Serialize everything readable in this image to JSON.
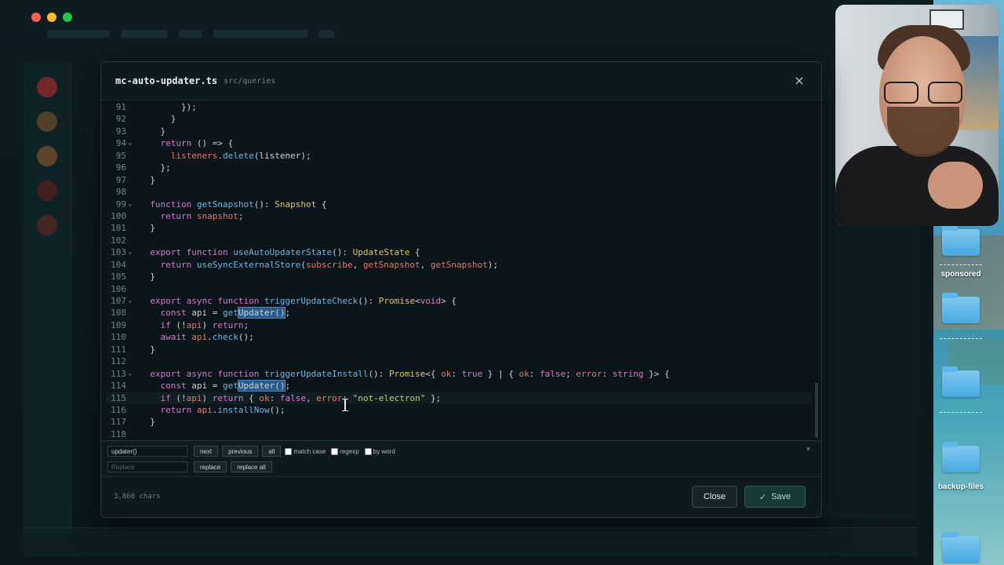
{
  "modal": {
    "filename": "mc-auto-updater.ts",
    "path": "src/queries",
    "close_icon": "×"
  },
  "editor": {
    "lines": [
      {
        "n": "91",
        "fold": "",
        "tokens": [
          [
            "id",
            "        });"
          ]
        ]
      },
      {
        "n": "92",
        "fold": "",
        "tokens": [
          [
            "id",
            "      }"
          ]
        ]
      },
      {
        "n": "93",
        "fold": "",
        "tokens": [
          [
            "id",
            "    }"
          ]
        ]
      },
      {
        "n": "94",
        "fold": "⌄",
        "tokens": [
          [
            "id",
            "    "
          ],
          [
            "kw",
            "return"
          ],
          [
            "id",
            " () => {"
          ]
        ]
      },
      {
        "n": "95",
        "fold": "",
        "tokens": [
          [
            "id",
            "      "
          ],
          [
            "pr",
            "listeners"
          ],
          [
            "id",
            "."
          ],
          [
            "fn",
            "delete"
          ],
          [
            "id",
            "(listener);"
          ]
        ]
      },
      {
        "n": "96",
        "fold": "",
        "tokens": [
          [
            "id",
            "    };"
          ]
        ]
      },
      {
        "n": "97",
        "fold": "",
        "tokens": [
          [
            "id",
            "  }"
          ]
        ]
      },
      {
        "n": "98",
        "fold": "",
        "tokens": []
      },
      {
        "n": "99",
        "fold": "⌄",
        "tokens": [
          [
            "id",
            "  "
          ],
          [
            "kw",
            "function"
          ],
          [
            "id",
            " "
          ],
          [
            "fn",
            "getSnapshot"
          ],
          [
            "id",
            "(): "
          ],
          [
            "ty",
            "Snapshot"
          ],
          [
            "id",
            " {"
          ]
        ]
      },
      {
        "n": "100",
        "fold": "",
        "tokens": [
          [
            "id",
            "    "
          ],
          [
            "kw",
            "return"
          ],
          [
            "id",
            " "
          ],
          [
            "pr",
            "snapshot"
          ],
          [
            "id",
            ";"
          ]
        ]
      },
      {
        "n": "101",
        "fold": "",
        "tokens": [
          [
            "id",
            "  }"
          ]
        ]
      },
      {
        "n": "102",
        "fold": "",
        "tokens": []
      },
      {
        "n": "103",
        "fold": "⌄",
        "tokens": [
          [
            "id",
            "  "
          ],
          [
            "kw",
            "export"
          ],
          [
            "id",
            " "
          ],
          [
            "kw",
            "function"
          ],
          [
            "id",
            " "
          ],
          [
            "fn",
            "useAutoUpdaterState"
          ],
          [
            "id",
            "(): "
          ],
          [
            "ty",
            "UpdateState"
          ],
          [
            "id",
            " {"
          ]
        ]
      },
      {
        "n": "104",
        "fold": "",
        "tokens": [
          [
            "id",
            "    "
          ],
          [
            "kw",
            "return"
          ],
          [
            "id",
            " "
          ],
          [
            "fn",
            "useSyncExternalStore"
          ],
          [
            "id",
            "("
          ],
          [
            "pr",
            "subscribe"
          ],
          [
            "id",
            ", "
          ],
          [
            "pr",
            "getSnapshot"
          ],
          [
            "id",
            ", "
          ],
          [
            "pr",
            "getSnapshot"
          ],
          [
            "id",
            ");"
          ]
        ]
      },
      {
        "n": "105",
        "fold": "",
        "tokens": [
          [
            "id",
            "  }"
          ]
        ]
      },
      {
        "n": "106",
        "fold": "",
        "tokens": []
      },
      {
        "n": "107",
        "fold": "⌄",
        "tokens": [
          [
            "id",
            "  "
          ],
          [
            "kw",
            "export"
          ],
          [
            "id",
            " "
          ],
          [
            "kw",
            "async"
          ],
          [
            "id",
            " "
          ],
          [
            "kw",
            "function"
          ],
          [
            "id",
            " "
          ],
          [
            "fn",
            "triggerUpdateCheck"
          ],
          [
            "id",
            "(): "
          ],
          [
            "ty",
            "Promise"
          ],
          [
            "id",
            "<"
          ],
          [
            "kw",
            "void"
          ],
          [
            "id",
            "> {"
          ]
        ]
      },
      {
        "n": "108",
        "fold": "",
        "tokens": [
          [
            "id",
            "    "
          ],
          [
            "kw",
            "const"
          ],
          [
            "id",
            " api = "
          ],
          [
            "fn",
            "get"
          ],
          [
            "hl",
            "Updater()"
          ],
          [
            "id",
            ";"
          ]
        ]
      },
      {
        "n": "109",
        "fold": "",
        "tokens": [
          [
            "id",
            "    "
          ],
          [
            "kw",
            "if"
          ],
          [
            "id",
            " (!"
          ],
          [
            "pr",
            "api"
          ],
          [
            "id",
            ") "
          ],
          [
            "kw",
            "return"
          ],
          [
            "id",
            ";"
          ]
        ]
      },
      {
        "n": "110",
        "fold": "",
        "tokens": [
          [
            "id",
            "    "
          ],
          [
            "kw",
            "await"
          ],
          [
            "id",
            " "
          ],
          [
            "pr",
            "api"
          ],
          [
            "id",
            "."
          ],
          [
            "fn",
            "check"
          ],
          [
            "id",
            "();"
          ]
        ]
      },
      {
        "n": "111",
        "fold": "",
        "tokens": [
          [
            "id",
            "  }"
          ]
        ]
      },
      {
        "n": "112",
        "fold": "",
        "tokens": []
      },
      {
        "n": "113",
        "fold": "⌄",
        "tokens": [
          [
            "id",
            "  "
          ],
          [
            "kw",
            "export"
          ],
          [
            "id",
            " "
          ],
          [
            "kw",
            "async"
          ],
          [
            "id",
            " "
          ],
          [
            "kw",
            "function"
          ],
          [
            "id",
            " "
          ],
          [
            "fn",
            "triggerUpdateInstall"
          ],
          [
            "id",
            "(): "
          ],
          [
            "ty",
            "Promise"
          ],
          [
            "id",
            "<{ "
          ],
          [
            "pr",
            "ok"
          ],
          [
            "id",
            ": "
          ],
          [
            "kw",
            "true"
          ],
          [
            "id",
            " } | { "
          ],
          [
            "pr",
            "ok"
          ],
          [
            "id",
            ": "
          ],
          [
            "kw",
            "false"
          ],
          [
            "id",
            "; "
          ],
          [
            "pr",
            "error"
          ],
          [
            "id",
            ": "
          ],
          [
            "kw",
            "string"
          ],
          [
            "id",
            " }> {"
          ]
        ]
      },
      {
        "n": "114",
        "fold": "",
        "tokens": [
          [
            "id",
            "    "
          ],
          [
            "kw",
            "const"
          ],
          [
            "id",
            " api = "
          ],
          [
            "fn",
            "get"
          ],
          [
            "hl",
            "Updater()"
          ],
          [
            "id",
            ";"
          ]
        ]
      },
      {
        "n": "115",
        "fold": "",
        "active": true,
        "tokens": [
          [
            "id",
            "    "
          ],
          [
            "kw",
            "if"
          ],
          [
            "id",
            " (!"
          ],
          [
            "pr",
            "api"
          ],
          [
            "id",
            ") "
          ],
          [
            "kw",
            "return"
          ],
          [
            "id",
            " { "
          ],
          [
            "pr",
            "ok"
          ],
          [
            "id",
            ": "
          ],
          [
            "kw",
            "false"
          ],
          [
            "id",
            ", "
          ],
          [
            "pr",
            "error"
          ],
          [
            "id",
            ": "
          ],
          [
            "str",
            "\"not-electron\""
          ],
          [
            "id",
            " };"
          ]
        ]
      },
      {
        "n": "116",
        "fold": "",
        "tokens": [
          [
            "id",
            "    "
          ],
          [
            "kw",
            "return"
          ],
          [
            "id",
            " "
          ],
          [
            "pr",
            "api"
          ],
          [
            "id",
            "."
          ],
          [
            "fn",
            "installNow"
          ],
          [
            "id",
            "();"
          ]
        ]
      },
      {
        "n": "117",
        "fold": "",
        "tokens": [
          [
            "id",
            "  }"
          ]
        ]
      },
      {
        "n": "118",
        "fold": "",
        "tokens": []
      }
    ]
  },
  "search": {
    "find_value": "updater()",
    "replace_placeholder": "Replace",
    "next_label": "next",
    "previous_label": "previous",
    "all_label": "all",
    "match_case_label": "match case",
    "regexp_label": "regexp",
    "by_word_label": "by word",
    "replace_label": "replace",
    "replace_all_label": "replace all",
    "close_icon": "×"
  },
  "footer": {
    "char_count": "3,860 chars",
    "close_label": "Close",
    "save_label": "Save",
    "save_icon": "✓"
  },
  "desktop": {
    "labels": [
      "sponsored",
      "backup-files"
    ]
  },
  "colors": {
    "keyword": "#d47ad0",
    "function": "#6fb6e8",
    "type": "#e3c16f",
    "string": "#b5d17a",
    "property": "#e07a6a",
    "accent_save": "#173a38"
  }
}
